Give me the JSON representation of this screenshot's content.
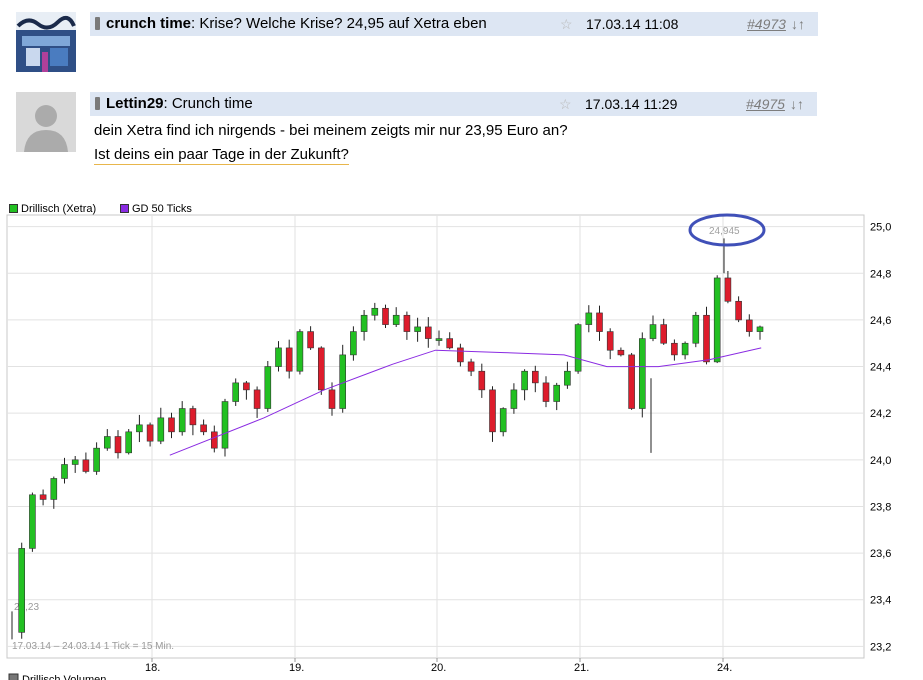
{
  "posts": [
    {
      "author": "crunch time",
      "title": ": Krise? Welche Krise? 24,95 auf Xetra eben",
      "date": "17.03.14 11:08",
      "number": "#4973",
      "arrows": "↓↑"
    },
    {
      "author": "Lettin29",
      "title": ": Crunch time",
      "date": "17.03.14 11:29",
      "number": "#4975",
      "arrows": "↓↑",
      "body_lines": [
        "dein Xetra find ich nirgends - bei meinem zeigts mir nur 23,95 Euro an?",
        " Ist deins ein paar Tage in der Zukunft?"
      ]
    }
  ],
  "icons": {
    "star": "star-icon",
    "post_type": "post-type-icon"
  },
  "chart_data": {
    "type": "candlestick",
    "legend": [
      {
        "name": "Drillisch (Xetra)",
        "color": "#22c022"
      },
      {
        "name": "GD 50 Ticks",
        "color": "#8a2be2"
      }
    ],
    "ylim": [
      23.15,
      25.05
    ],
    "yticks": [
      "25,0",
      "24,8",
      "24,6",
      "24,4",
      "24,2",
      "24,0",
      "23,8",
      "23,6",
      "23,4",
      "23,2"
    ],
    "ytick_values": [
      25.0,
      24.8,
      24.6,
      24.4,
      24.2,
      24.0,
      23.8,
      23.6,
      23.4,
      23.2
    ],
    "xticks": [
      "18.",
      "19.",
      "20.",
      "21.",
      "24."
    ],
    "x_period": "17.03.14 – 24.03.14   1 Tick = 15 Min.",
    "min_label": "23,23",
    "max_label": "24,945",
    "grid": true,
    "bottom_legend": "Drillisch Volumen",
    "up_color": "#22c022",
    "down_color": "#dd1c2c",
    "ma_color": "#8a2be2",
    "highlight_color": "#4050b8",
    "close_path": [
      23.26,
      23.62,
      23.85,
      23.83,
      23.92,
      23.98,
      24.0,
      23.95,
      24.05,
      24.1,
      24.03,
      24.12,
      24.15,
      24.08,
      24.18,
      24.12,
      24.22,
      24.15,
      24.12,
      24.05,
      24.25,
      24.33,
      24.3,
      24.22,
      24.4,
      24.48,
      24.38,
      24.55,
      24.48,
      24.3,
      24.22,
      24.45,
      24.55,
      24.62,
      24.65,
      24.58,
      24.62,
      24.55,
      24.57,
      24.52,
      24.52,
      24.48,
      24.42,
      24.38,
      24.3,
      24.12,
      24.22,
      24.3,
      24.38,
      24.33,
      24.25,
      24.32,
      24.38,
      24.58,
      24.63,
      24.55,
      24.47,
      24.45,
      24.22,
      24.52,
      24.58,
      24.5,
      24.45,
      24.5,
      24.62,
      24.42,
      24.78,
      24.68,
      24.6,
      24.55,
      24.57
    ],
    "ma_path": [
      [
        0.19,
        24.02
      ],
      [
        0.3,
        24.18
      ],
      [
        0.37,
        24.3
      ],
      [
        0.45,
        24.41
      ],
      [
        0.5,
        24.47
      ],
      [
        0.58,
        24.46
      ],
      [
        0.65,
        24.45
      ],
      [
        0.7,
        24.4
      ],
      [
        0.76,
        24.4
      ],
      [
        0.82,
        24.43
      ],
      [
        0.88,
        24.48
      ]
    ]
  }
}
